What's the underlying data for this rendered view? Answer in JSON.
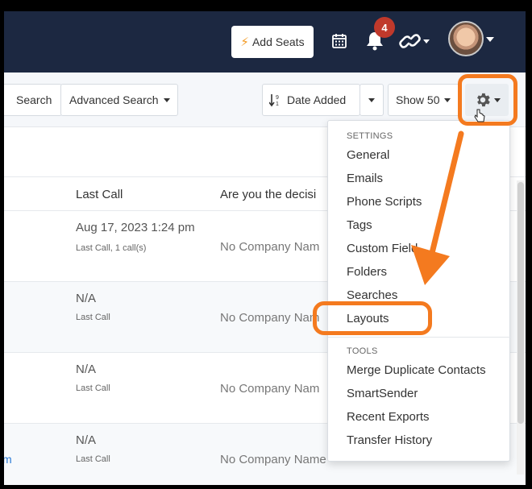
{
  "header": {
    "add_seats_label": "Add Seats",
    "notification_count": "4",
    "icons": [
      "bolt-icon",
      "calendar-icon",
      "bell-icon",
      "link-icon",
      "avatar",
      "chevron-down-icon"
    ],
    "colors": {
      "navbar": "#1c2841",
      "badge": "#c0392b",
      "highlight": "#f47a1f",
      "link": "#2a7ad6"
    }
  },
  "toolbar": {
    "search_label": "Search",
    "advanced_search_label": "Advanced Search",
    "sort_label": "Date Added",
    "show_label": "Show 50"
  },
  "table": {
    "columns": {
      "last_call": "Last Call",
      "decision": "Are you the decisi"
    },
    "rows": [
      {
        "last_call": "Aug 17, 2023 1:24 pm",
        "sub": "Last Call, 1 call(s)",
        "company": "No Company Nam",
        "link": ""
      },
      {
        "last_call": "N/A",
        "sub": "Last Call",
        "company": "No Company Nam",
        "link": ""
      },
      {
        "last_call": "N/A",
        "sub": "Last Call",
        "company": "No Company Nam",
        "link": ""
      },
      {
        "last_call": "N/A",
        "sub": "Last Call",
        "company": "No Company Name",
        "link": "m"
      }
    ]
  },
  "settings_menu": {
    "settings_header": "SETTINGS",
    "settings_items": [
      "General",
      "Emails",
      "Phone Scripts",
      "Tags",
      "Custom Field",
      "Folders",
      "Searches",
      "Layouts"
    ],
    "tools_header": "TOOLS",
    "tools_items": [
      "Merge Duplicate Contacts",
      "SmartSender",
      "Recent Exports",
      "Transfer History"
    ]
  }
}
